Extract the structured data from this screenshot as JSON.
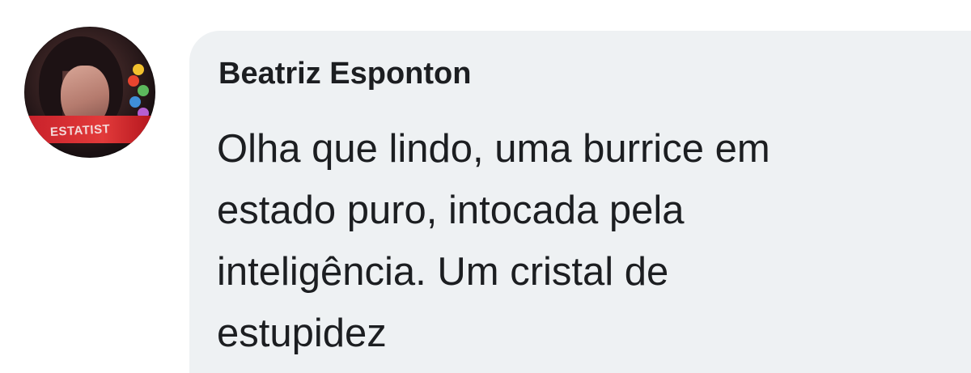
{
  "comment": {
    "author": "Beatriz Esponton",
    "text_lines": [
      "Olha que lindo, uma burrice em",
      "estado puro, intocada pela",
      "inteligência. Um cristal de",
      "estupidez"
    ],
    "avatar": {
      "banner_text": "ESTATIST",
      "dot_colors": [
        "#f2c12e",
        "#e8452f",
        "#5cb85c",
        "#3f8fd8",
        "#b55fd1"
      ]
    }
  },
  "colors": {
    "bubble_bg": "#eef1f3",
    "text": "#1c1e21",
    "page_bg": "#ffffff"
  }
}
